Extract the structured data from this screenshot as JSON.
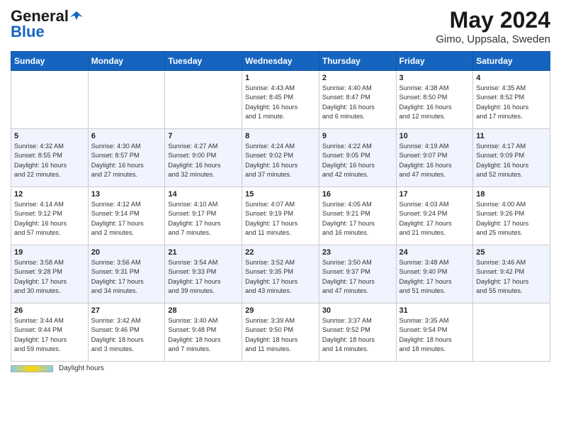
{
  "app": {
    "logo_general": "General",
    "logo_blue": "Blue",
    "title": "May 2024",
    "subtitle": "Gimo, Uppsala, Sweden"
  },
  "footer": {
    "daylight_label": "Daylight hours"
  },
  "days_of_week": [
    "Sunday",
    "Monday",
    "Tuesday",
    "Wednesday",
    "Thursday",
    "Friday",
    "Saturday"
  ],
  "weeks": [
    [
      {
        "day": "",
        "info": ""
      },
      {
        "day": "",
        "info": ""
      },
      {
        "day": "",
        "info": ""
      },
      {
        "day": "1",
        "info": "Sunrise: 4:43 AM\nSunset: 8:45 PM\nDaylight: 16 hours\nand 1 minute."
      },
      {
        "day": "2",
        "info": "Sunrise: 4:40 AM\nSunset: 8:47 PM\nDaylight: 16 hours\nand 6 minutes."
      },
      {
        "day": "3",
        "info": "Sunrise: 4:38 AM\nSunset: 8:50 PM\nDaylight: 16 hours\nand 12 minutes."
      },
      {
        "day": "4",
        "info": "Sunrise: 4:35 AM\nSunset: 8:52 PM\nDaylight: 16 hours\nand 17 minutes."
      }
    ],
    [
      {
        "day": "5",
        "info": "Sunrise: 4:32 AM\nSunset: 8:55 PM\nDaylight: 16 hours\nand 22 minutes."
      },
      {
        "day": "6",
        "info": "Sunrise: 4:30 AM\nSunset: 8:57 PM\nDaylight: 16 hours\nand 27 minutes."
      },
      {
        "day": "7",
        "info": "Sunrise: 4:27 AM\nSunset: 9:00 PM\nDaylight: 16 hours\nand 32 minutes."
      },
      {
        "day": "8",
        "info": "Sunrise: 4:24 AM\nSunset: 9:02 PM\nDaylight: 16 hours\nand 37 minutes."
      },
      {
        "day": "9",
        "info": "Sunrise: 4:22 AM\nSunset: 9:05 PM\nDaylight: 16 hours\nand 42 minutes."
      },
      {
        "day": "10",
        "info": "Sunrise: 4:19 AM\nSunset: 9:07 PM\nDaylight: 16 hours\nand 47 minutes."
      },
      {
        "day": "11",
        "info": "Sunrise: 4:17 AM\nSunset: 9:09 PM\nDaylight: 16 hours\nand 52 minutes."
      }
    ],
    [
      {
        "day": "12",
        "info": "Sunrise: 4:14 AM\nSunset: 9:12 PM\nDaylight: 16 hours\nand 57 minutes."
      },
      {
        "day": "13",
        "info": "Sunrise: 4:12 AM\nSunset: 9:14 PM\nDaylight: 17 hours\nand 2 minutes."
      },
      {
        "day": "14",
        "info": "Sunrise: 4:10 AM\nSunset: 9:17 PM\nDaylight: 17 hours\nand 7 minutes."
      },
      {
        "day": "15",
        "info": "Sunrise: 4:07 AM\nSunset: 9:19 PM\nDaylight: 17 hours\nand 11 minutes."
      },
      {
        "day": "16",
        "info": "Sunrise: 4:05 AM\nSunset: 9:21 PM\nDaylight: 17 hours\nand 16 minutes."
      },
      {
        "day": "17",
        "info": "Sunrise: 4:03 AM\nSunset: 9:24 PM\nDaylight: 17 hours\nand 21 minutes."
      },
      {
        "day": "18",
        "info": "Sunrise: 4:00 AM\nSunset: 9:26 PM\nDaylight: 17 hours\nand 25 minutes."
      }
    ],
    [
      {
        "day": "19",
        "info": "Sunrise: 3:58 AM\nSunset: 9:28 PM\nDaylight: 17 hours\nand 30 minutes."
      },
      {
        "day": "20",
        "info": "Sunrise: 3:56 AM\nSunset: 9:31 PM\nDaylight: 17 hours\nand 34 minutes."
      },
      {
        "day": "21",
        "info": "Sunrise: 3:54 AM\nSunset: 9:33 PM\nDaylight: 17 hours\nand 39 minutes."
      },
      {
        "day": "22",
        "info": "Sunrise: 3:52 AM\nSunset: 9:35 PM\nDaylight: 17 hours\nand 43 minutes."
      },
      {
        "day": "23",
        "info": "Sunrise: 3:50 AM\nSunset: 9:37 PM\nDaylight: 17 hours\nand 47 minutes."
      },
      {
        "day": "24",
        "info": "Sunrise: 3:48 AM\nSunset: 9:40 PM\nDaylight: 17 hours\nand 51 minutes."
      },
      {
        "day": "25",
        "info": "Sunrise: 3:46 AM\nSunset: 9:42 PM\nDaylight: 17 hours\nand 55 minutes."
      }
    ],
    [
      {
        "day": "26",
        "info": "Sunrise: 3:44 AM\nSunset: 9:44 PM\nDaylight: 17 hours\nand 59 minutes."
      },
      {
        "day": "27",
        "info": "Sunrise: 3:42 AM\nSunset: 9:46 PM\nDaylight: 18 hours\nand 3 minutes."
      },
      {
        "day": "28",
        "info": "Sunrise: 3:40 AM\nSunset: 9:48 PM\nDaylight: 18 hours\nand 7 minutes."
      },
      {
        "day": "29",
        "info": "Sunrise: 3:39 AM\nSunset: 9:50 PM\nDaylight: 18 hours\nand 11 minutes."
      },
      {
        "day": "30",
        "info": "Sunrise: 3:37 AM\nSunset: 9:52 PM\nDaylight: 18 hours\nand 14 minutes."
      },
      {
        "day": "31",
        "info": "Sunrise: 3:35 AM\nSunset: 9:54 PM\nDaylight: 18 hours\nand 18 minutes."
      },
      {
        "day": "",
        "info": ""
      }
    ]
  ]
}
